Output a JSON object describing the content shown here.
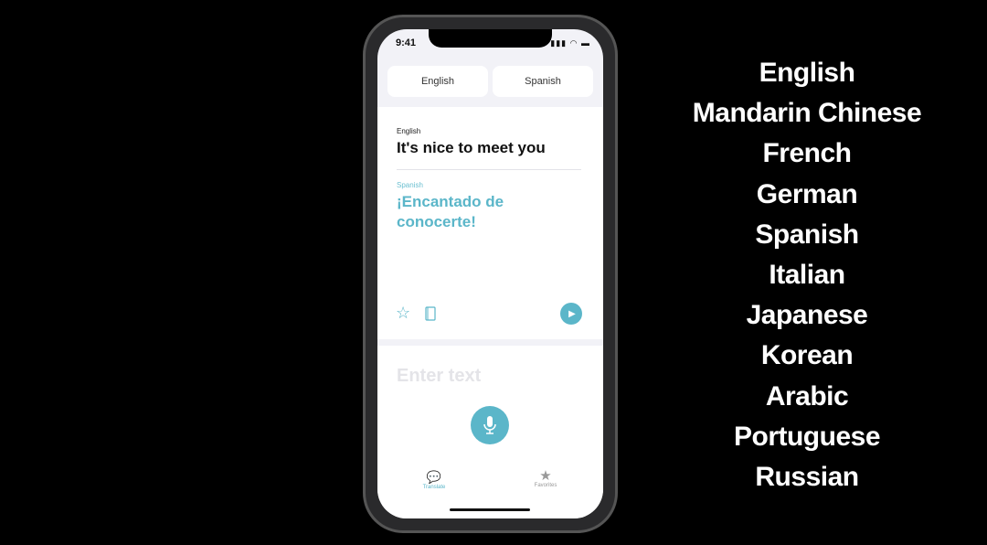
{
  "status_bar": {
    "time": "9:41",
    "signal": "▮▮▮ ◠ ▬"
  },
  "language_selector": {
    "source": "English",
    "target": "Spanish"
  },
  "translation": {
    "source_label": "English",
    "source_text": "It's nice to meet you",
    "target_label": "Spanish",
    "target_text": "¡Encantado de conocerte!"
  },
  "input": {
    "placeholder": "Enter text"
  },
  "tabs": [
    {
      "label": "Translate",
      "icon": "translate-icon",
      "active": true
    },
    {
      "label": "Favorites",
      "icon": "star-icon",
      "active": false
    }
  ],
  "languages": [
    "English",
    "Mandarin Chinese",
    "French",
    "German",
    "Spanish",
    "Italian",
    "Japanese",
    "Korean",
    "Arabic",
    "Portuguese",
    "Russian"
  ],
  "colors": {
    "accent": "#5bb6c9",
    "background": "#000000"
  }
}
